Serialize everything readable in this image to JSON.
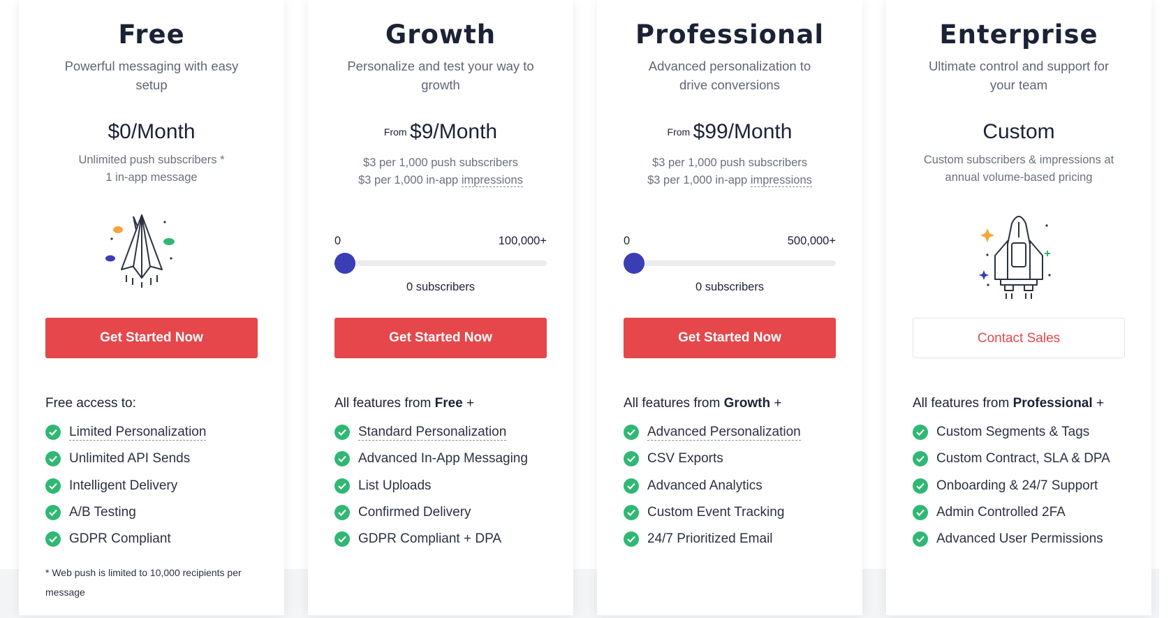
{
  "plans": [
    {
      "name": "Free",
      "description": "Powerful messaging with easy setup",
      "price_prefix": "",
      "price": "$0/Month",
      "price_note_1": "Unlimited push subscribers *",
      "price_note_2": "1 in-app message",
      "illustration": "paper-plane",
      "cta": "Get Started Now",
      "features_heading_text": "Free access to:",
      "features": [
        "Limited Personalization",
        "Unlimited API Sends",
        "Intelligent Delivery",
        "A/B Testing",
        "GDPR Compliant"
      ],
      "footnote": "* Web push is limited to 10,000 recipients per message"
    },
    {
      "name": "Growth",
      "description": "Personalize and test your way to growth",
      "price_prefix": "From",
      "price": "$9/Month",
      "price_note_1": "$3 per 1,000 push subscribers",
      "price_note_2_prefix": "$3 per 1,000 in-app",
      "price_note_2_link": "impressions",
      "slider": {
        "min_label": "0",
        "max_label": "100,000+",
        "value_fraction": 0,
        "count_label": "0 subscribers"
      },
      "cta": "Get Started Now",
      "features_heading_prefix": "All features from",
      "features_heading_plan": "Free",
      "features_heading_suffix": "+",
      "features": [
        "Standard Personalization",
        "Advanced In-App Messaging",
        "List Uploads",
        "Confirmed Delivery",
        "GDPR Compliant + DPA"
      ]
    },
    {
      "name": "Professional",
      "description": "Advanced personalization to drive conversions",
      "price_prefix": "From",
      "price": "$99/Month",
      "price_note_1": "$3 per 1,000 push subscribers",
      "price_note_2_prefix": "$3 per 1,000 in-app",
      "price_note_2_link": "impressions",
      "slider": {
        "min_label": "0",
        "max_label": "500,000+",
        "value_fraction": 0,
        "count_label": "0 subscribers"
      },
      "cta": "Get Started Now",
      "features_heading_prefix": "All features from",
      "features_heading_plan": "Growth",
      "features_heading_suffix": "+",
      "features": [
        "Advanced Personalization",
        "CSV Exports",
        "Advanced Analytics",
        "Custom Event Tracking",
        "24/7 Prioritized Email"
      ]
    },
    {
      "name": "Enterprise",
      "description": "Ultimate control and support for your team",
      "price_prefix": "",
      "price": "Custom",
      "price_note_1": "Custom subscribers & impressions at",
      "price_note_2": "annual volume-based pricing",
      "illustration": "rocket",
      "cta": "Contact Sales",
      "features_heading_prefix": "All features from",
      "features_heading_plan": "Professional",
      "features_heading_suffix": "+",
      "features": [
        "Custom Segments & Tags",
        "Custom Contract, SLA & DPA",
        "Onboarding & 24/7 Support",
        "Admin Controlled 2FA",
        "Advanced User Permissions"
      ]
    }
  ],
  "colors": {
    "accent": "#e5474a",
    "check": "#2fb872",
    "slider": "#3a3db3",
    "heading": "#1b2235"
  },
  "icons": {
    "check": "check-circle-icon"
  }
}
